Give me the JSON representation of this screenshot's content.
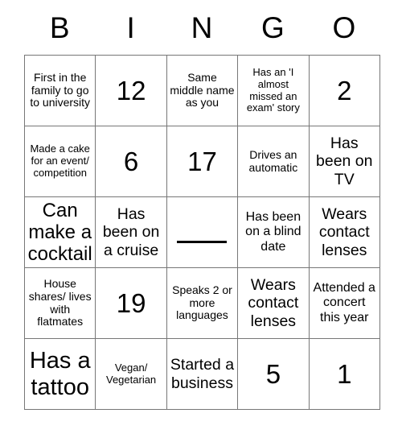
{
  "card": {
    "title_letters": [
      "B",
      "I",
      "N",
      "G",
      "O"
    ],
    "rows": [
      [
        {
          "text": "First in the family to go to university",
          "size": "sz-s",
          "kind": "prompt"
        },
        {
          "text": "12",
          "size": "sz-num",
          "kind": "number"
        },
        {
          "text": "Same middle name as you",
          "size": "sz-s",
          "kind": "prompt"
        },
        {
          "text": "Has an 'I almost missed an exam' story",
          "size": "sz-xs",
          "kind": "prompt"
        },
        {
          "text": "2",
          "size": "sz-num",
          "kind": "number"
        }
      ],
      [
        {
          "text": "Made a cake for an event/ competition",
          "size": "sz-xs",
          "kind": "prompt"
        },
        {
          "text": "6",
          "size": "sz-num",
          "kind": "number"
        },
        {
          "text": "17",
          "size": "sz-num",
          "kind": "number"
        },
        {
          "text": "Drives an automatic",
          "size": "sz-s",
          "kind": "prompt"
        },
        {
          "text": "Has been on TV",
          "size": "sz-l",
          "kind": "prompt"
        }
      ],
      [
        {
          "text": "Can make a cocktail",
          "size": "sz-xl",
          "kind": "prompt"
        },
        {
          "text": "Has been on a cruise",
          "size": "sz-l",
          "kind": "prompt"
        },
        {
          "text": "",
          "size": "sz-m",
          "kind": "free-space"
        },
        {
          "text": "Has been on a blind date",
          "size": "sz-m",
          "kind": "prompt"
        },
        {
          "text": "Wears contact lenses",
          "size": "sz-l",
          "kind": "prompt"
        }
      ],
      [
        {
          "text": "House shares/ lives with flatmates",
          "size": "sz-s",
          "kind": "prompt"
        },
        {
          "text": "19",
          "size": "sz-num",
          "kind": "number"
        },
        {
          "text": "Speaks 2 or more languages",
          "size": "sz-s",
          "kind": "prompt"
        },
        {
          "text": "Wears contact lenses",
          "size": "sz-l",
          "kind": "prompt"
        },
        {
          "text": "Attended a concert this year",
          "size": "sz-m",
          "kind": "prompt"
        }
      ],
      [
        {
          "text": "Has a tattoo",
          "size": "sz-big",
          "kind": "prompt"
        },
        {
          "text": "Vegan/ Vegetarian",
          "size": "sz-xs",
          "kind": "prompt"
        },
        {
          "text": "Started a business",
          "size": "sz-l",
          "kind": "prompt"
        },
        {
          "text": "5",
          "size": "sz-num",
          "kind": "number"
        },
        {
          "text": "1",
          "size": "sz-num",
          "kind": "number"
        }
      ]
    ]
  }
}
